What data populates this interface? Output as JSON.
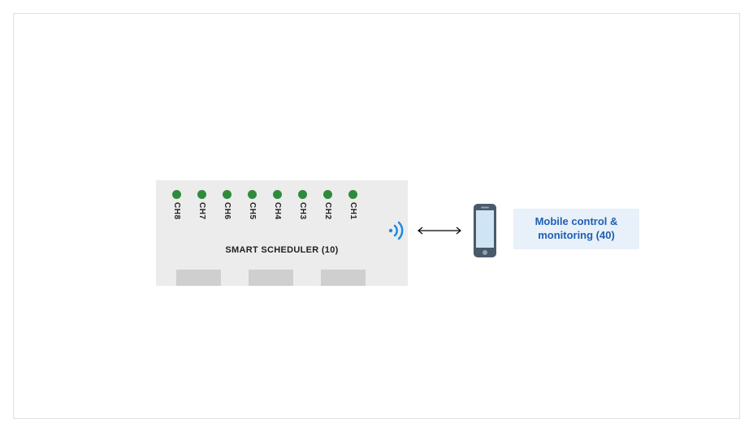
{
  "scheduler": {
    "title": "SMART SCHEDULER (10)",
    "channels": [
      "CH8",
      "CH7",
      "CH6",
      "CH5",
      "CH4",
      "CH3",
      "CH2",
      "CH1"
    ],
    "led_color": "#2e8b3c",
    "slot_count": 3
  },
  "mobile": {
    "label": "Mobile control & monitoring (40)"
  },
  "colors": {
    "scheduler_bg": "#ececec",
    "slot_bg": "#cfcfcf",
    "mobile_box_bg": "#e8f0fa",
    "mobile_text": "#1e5fb3",
    "wifi": "#1e88e5",
    "phone_body": "#4a5a6a",
    "phone_screen": "#cfe4f5"
  }
}
